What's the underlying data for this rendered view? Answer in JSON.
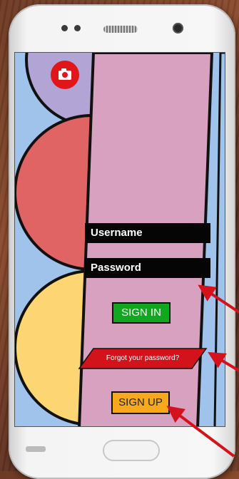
{
  "login": {
    "username_placeholder": "Username",
    "password_placeholder": "Password",
    "signin_label": "SIGN IN",
    "forgot_label": "Forgot your password?",
    "signup_label": "SIGN UP"
  },
  "icons": {
    "camera": "camera-icon",
    "arrows": "annotation-arrow"
  },
  "colors": {
    "screen_bg": "#9fc3ea",
    "panel": "#d9a1c0",
    "circle_top": "#b3a4d6",
    "circle_mid": "#e06463",
    "circle_bottom": "#fdd673",
    "signin": "#11a820",
    "forgot": "#d4121b",
    "signup": "#f7a81c",
    "camera_button": "#e0161b",
    "arrow": "#d4121b"
  }
}
